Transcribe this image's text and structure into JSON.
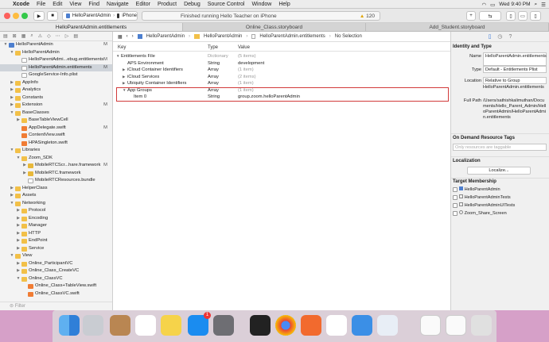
{
  "menubar": {
    "app": "Xcode",
    "items": [
      "File",
      "Edit",
      "View",
      "Find",
      "Navigate",
      "Editor",
      "Product",
      "Debug",
      "Source Control",
      "Window",
      "Help"
    ],
    "clock": "Wed 9:40 PM"
  },
  "toolbar": {
    "scheme": "HelloParentAdmin",
    "device": "iPhone",
    "status": "Finished running Hello Teacher on iPhone",
    "warnings": "120"
  },
  "tabs": [
    "HelloParentAdmin.entitlements",
    "Online_Class.storyboard",
    "Add_Student.storyboard"
  ],
  "navigator": {
    "filter_placeholder": "Filter",
    "rows": [
      {
        "label": "HelloParentAdmin",
        "depth": 0,
        "icon": "proj",
        "open": true,
        "status": "M"
      },
      {
        "label": "HelloParentAdmin",
        "depth": 1,
        "icon": "folder",
        "open": true,
        "status": ""
      },
      {
        "label": "HelloParentAdmi...ebug.entitlements",
        "depth": 2,
        "icon": "file",
        "status": "M"
      },
      {
        "label": "HelloParentAdmin.entitlements",
        "depth": 2,
        "icon": "file",
        "status": "M",
        "selected": true
      },
      {
        "label": "GoogleService-Info.plist",
        "depth": 2,
        "icon": "file",
        "status": ""
      },
      {
        "label": "AppInfo",
        "depth": 1,
        "icon": "folder",
        "open": false,
        "status": ""
      },
      {
        "label": "Analytics",
        "depth": 1,
        "icon": "folder",
        "open": false,
        "status": ""
      },
      {
        "label": "Constants",
        "depth": 1,
        "icon": "folder",
        "open": false,
        "status": ""
      },
      {
        "label": "Extension",
        "depth": 1,
        "icon": "folder",
        "open": false,
        "status": "M"
      },
      {
        "label": "BaseClasses",
        "depth": 1,
        "icon": "folder",
        "open": true,
        "status": ""
      },
      {
        "label": "BaseTableViewCell",
        "depth": 2,
        "icon": "folder",
        "open": false,
        "status": ""
      },
      {
        "label": "AppDelegate.swift",
        "depth": 2,
        "icon": "swift",
        "status": "M"
      },
      {
        "label": "ContentView.swift",
        "depth": 2,
        "icon": "swift",
        "status": ""
      },
      {
        "label": "HPASingleton.swift",
        "depth": 2,
        "icon": "swift",
        "status": ""
      },
      {
        "label": "Libraries",
        "depth": 1,
        "icon": "folder",
        "open": true,
        "status": ""
      },
      {
        "label": "Zoom_SDK",
        "depth": 2,
        "icon": "folder",
        "open": true,
        "status": ""
      },
      {
        "label": "MobileRTCScr...hare.framework",
        "depth": 3,
        "icon": "framework",
        "open": false,
        "status": "M"
      },
      {
        "label": "MobileRTC.framework",
        "depth": 3,
        "icon": "framework",
        "open": false,
        "status": ""
      },
      {
        "label": "MobileRTCResources.bundle",
        "depth": 3,
        "icon": "file",
        "status": ""
      },
      {
        "label": "HelperClass",
        "depth": 1,
        "icon": "folder",
        "open": false,
        "status": ""
      },
      {
        "label": "Assets",
        "depth": 1,
        "icon": "folder",
        "open": false,
        "status": ""
      },
      {
        "label": "Networking",
        "depth": 1,
        "icon": "folder",
        "open": true,
        "status": ""
      },
      {
        "label": "Protocol",
        "depth": 2,
        "icon": "folder",
        "open": false,
        "status": ""
      },
      {
        "label": "Encoding",
        "depth": 2,
        "icon": "folder",
        "open": false,
        "status": ""
      },
      {
        "label": "Manager",
        "depth": 2,
        "icon": "folder",
        "open": false,
        "status": ""
      },
      {
        "label": "HTTP",
        "depth": 2,
        "icon": "folder",
        "open": false,
        "status": ""
      },
      {
        "label": "EndPoint",
        "depth": 2,
        "icon": "folder",
        "open": false,
        "status": ""
      },
      {
        "label": "Service",
        "depth": 2,
        "icon": "folder",
        "open": false,
        "status": ""
      },
      {
        "label": "View",
        "depth": 1,
        "icon": "folder",
        "open": true,
        "status": ""
      },
      {
        "label": "Online_ParticipantVC",
        "depth": 2,
        "icon": "folder",
        "open": false,
        "status": ""
      },
      {
        "label": "Online_Class_CreateVC",
        "depth": 2,
        "icon": "folder",
        "open": false,
        "status": ""
      },
      {
        "label": "Online_ClassVC",
        "depth": 2,
        "icon": "folder",
        "open": true,
        "status": ""
      },
      {
        "label": "Online_Class+TableView.swift",
        "depth": 3,
        "icon": "swift",
        "status": ""
      },
      {
        "label": "Online_ClassVC.swift",
        "depth": 3,
        "icon": "swift",
        "status": ""
      }
    ]
  },
  "editor": {
    "jumpbar": [
      "HelloParentAdmin",
      "HelloParentAdmin",
      "HelloParentAdmin.entitlements",
      "No Selection"
    ],
    "columns": [
      "Key",
      "Type",
      "Value"
    ],
    "rows": [
      {
        "key": "Entitlements File",
        "type": "Dictionary",
        "value": "(5 items)",
        "depth": 0,
        "disc": "▼",
        "dim": true
      },
      {
        "key": "APS Environment",
        "type": "String",
        "value": "development",
        "depth": 1,
        "disc": "",
        "dim": false
      },
      {
        "key": "iCloud Container Identifiers",
        "type": "Array",
        "value": "(1 item)",
        "depth": 1,
        "disc": "▶",
        "dim": true
      },
      {
        "key": "iCloud Services",
        "type": "Array",
        "value": "(2 items)",
        "depth": 1,
        "disc": "▶",
        "dim": true
      },
      {
        "key": "Ubiquity Container Identifiers",
        "type": "Array",
        "value": "(1 item)",
        "depth": 1,
        "disc": "▶",
        "dim": true
      },
      {
        "key": "App Groups",
        "type": "Array",
        "value": "(1 item)",
        "depth": 1,
        "disc": "▼",
        "dim": true
      },
      {
        "key": "Item 0",
        "type": "String",
        "value": "group.zoom.helloParentAdmin",
        "depth": 2,
        "disc": "",
        "dim": false
      }
    ]
  },
  "inspector": {
    "identity_header": "Identity and Type",
    "name_label": "Name",
    "name_value": "HelloParentAdmin.entitlements",
    "type_label": "Type",
    "type_value": "Default - Entitlements Plist",
    "location_label": "Location",
    "location_value": "Relative to Group",
    "location_file": "HelloParentAdmin.entitlements",
    "fullpath_label": "Full Path",
    "fullpath_value": "/Users/sathishkalimuthan/Documents/Hello_Parent_Admin/HelloParentAdmin/HelloParentAdmin.entitlements",
    "odr_header": "On Demand Resource Tags",
    "odr_placeholder": "Only resources are taggable",
    "localization_header": "Localization",
    "localize_button": "Localize...",
    "target_header": "Target Membership",
    "targets": [
      "HelloParentAdmin",
      "HelloParentAdminTests",
      "HelloParentAdminUITests",
      "Zoom_Share_Screen"
    ]
  },
  "dock": {
    "appstore_badge": "1",
    "apps": [
      "finder",
      "launchpad",
      "contacts",
      "reminders",
      "notes",
      "app-store",
      "system-preferences",
      "terminal",
      "chrome",
      "swift-playgrounds",
      "slack",
      "xcode",
      "preview",
      "documents",
      "downloads",
      "trash"
    ]
  }
}
